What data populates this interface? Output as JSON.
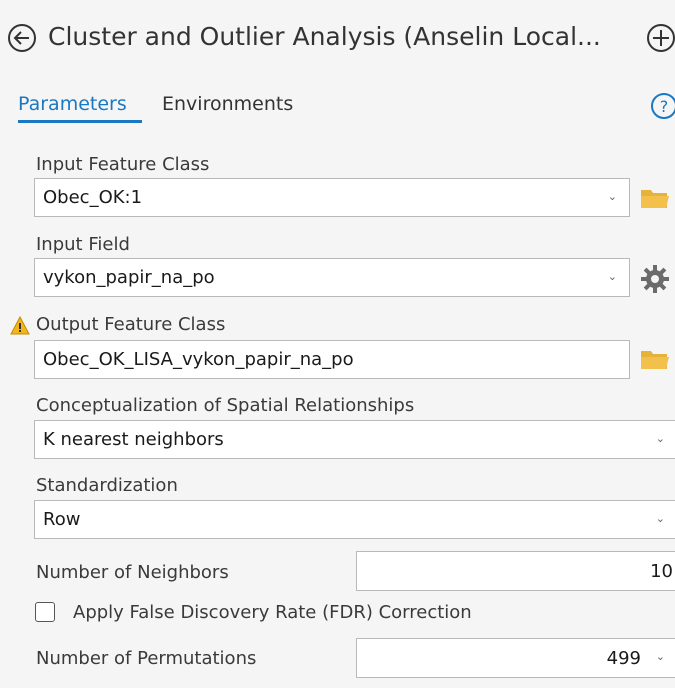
{
  "header": {
    "title": "Cluster and Outlier Analysis (Anselin Local...",
    "back_icon": "back-circle-icon",
    "add_icon": "add-circle-icon"
  },
  "tabs": [
    {
      "label": "Parameters",
      "active": true
    },
    {
      "label": "Environments",
      "active": false
    }
  ],
  "help_icon": "help-circle-icon",
  "colors": {
    "accent": "#1a78c2",
    "warning": "#e8a100",
    "folder": "#f2c04b"
  },
  "params": {
    "input_feature_class": {
      "label": "Input Feature Class",
      "value": "Obec_OK:1"
    },
    "input_field": {
      "label": "Input Field",
      "value": "vykon_papir_na_po"
    },
    "output_feature_class": {
      "label": "Output Feature Class",
      "value": "Obec_OK_LISA_vykon_papir_na_po"
    },
    "conceptualization": {
      "label": "Conceptualization of Spatial Relationships",
      "value": "K nearest neighbors"
    },
    "standardization": {
      "label": "Standardization",
      "value": "Row"
    },
    "number_of_neighbors": {
      "label": "Number of Neighbors",
      "value": "10"
    },
    "fdr": {
      "label": "Apply False Discovery Rate (FDR) Correction",
      "checked": false
    },
    "number_of_permutations": {
      "label": "Number of Permutations",
      "value": "499"
    }
  }
}
